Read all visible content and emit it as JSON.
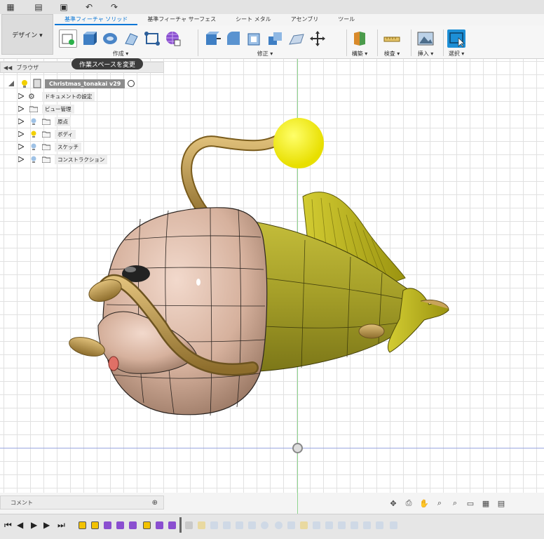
{
  "tabs": [
    "基準フィーチャ ソリッド",
    "基準フィーチャ サーフェス",
    "シート メタル",
    "アセンブリ",
    "ツール"
  ],
  "workspace_button": "デザイン ▾",
  "ribbon_groups": {
    "create": "作成 ▾",
    "modify": "修正 ▾",
    "construct": "構築 ▾",
    "inspect": "検査 ▾",
    "insert": "挿入 ▾",
    "select": "選択 ▾"
  },
  "browser": {
    "title": "ブラウザ",
    "tooltip": "作業スペースを変更",
    "root": "Christmas_tonakai v29",
    "items": [
      "ドキュメントの設定",
      "ビュー管理",
      "原点",
      "ボディ",
      "スケッチ",
      "コンストラクション"
    ]
  },
  "comment_label": "コメント",
  "colors": {
    "accent": "#0b77d6",
    "body_skin": "#d9b7a4",
    "body_gold": "#a7a22a",
    "lure": "#f5f000",
    "select_button": "#1d8fd6"
  }
}
